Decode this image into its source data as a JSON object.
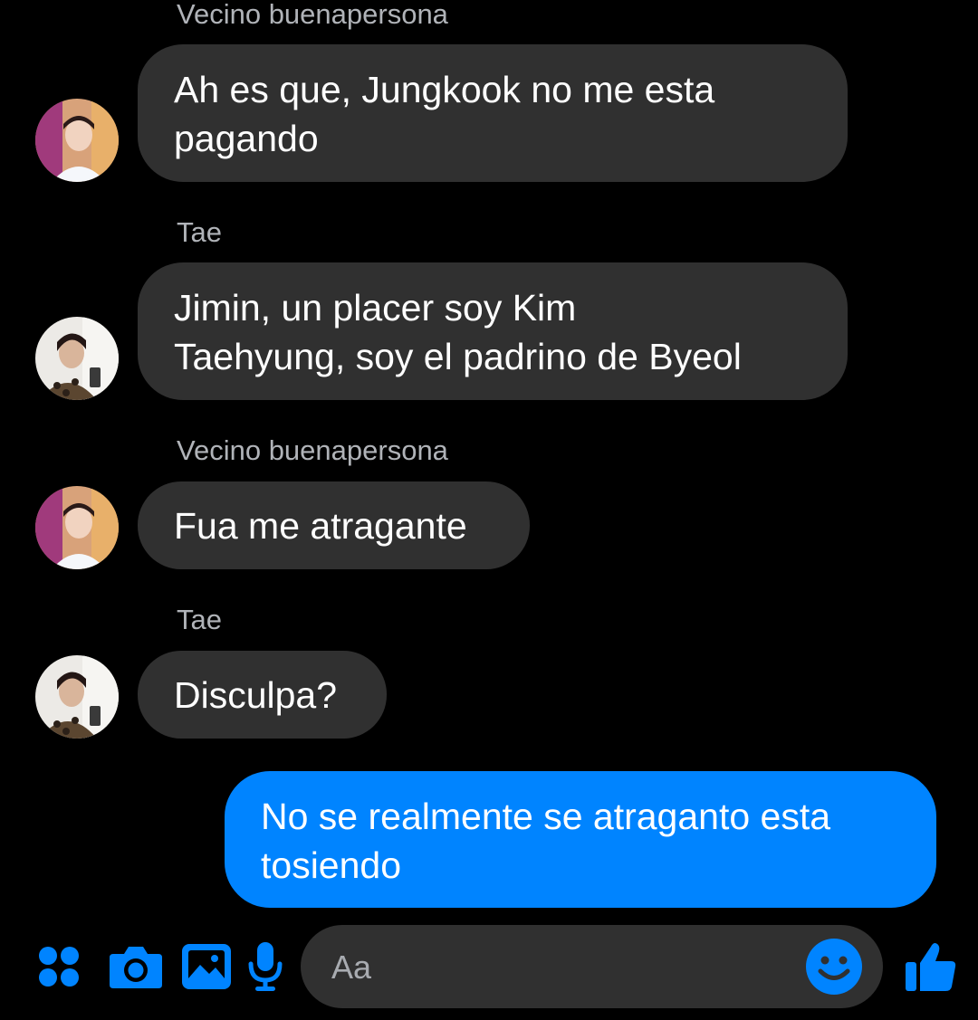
{
  "conversation": {
    "messages": [
      {
        "sender": "Vecino buenapersona",
        "direction": "incoming",
        "avatar_icon": "jimin-avatar",
        "text": "Ah es que, Jungkook no me esta\npagando"
      },
      {
        "sender": "Tae",
        "direction": "incoming",
        "avatar_icon": "tae-avatar",
        "text": "Jimin, un placer soy Kim\nTaehyung, soy el padrino de Byeol"
      },
      {
        "sender": "Vecino buenapersona",
        "direction": "incoming",
        "avatar_icon": "jimin-avatar",
        "text": "Fua me atragante"
      },
      {
        "sender": "Tae",
        "direction": "incoming",
        "avatar_icon": "tae-avatar",
        "text": "Disculpa?"
      },
      {
        "sender": "",
        "direction": "outgoing",
        "text": "No se realmente se atraganto esta\ntosiendo"
      }
    ]
  },
  "composer": {
    "placeholder": "Aa",
    "icons": [
      "menu-dots-icon",
      "camera-icon",
      "gallery-icon",
      "microphone-icon",
      "emoji-icon",
      "thumbs-up-icon"
    ]
  },
  "colors": {
    "background": "#000000",
    "incoming_bubble": "#303030",
    "outgoing_bubble": "#0084ff",
    "accent": "#0084ff",
    "sender_name": "#b0b3b8"
  }
}
